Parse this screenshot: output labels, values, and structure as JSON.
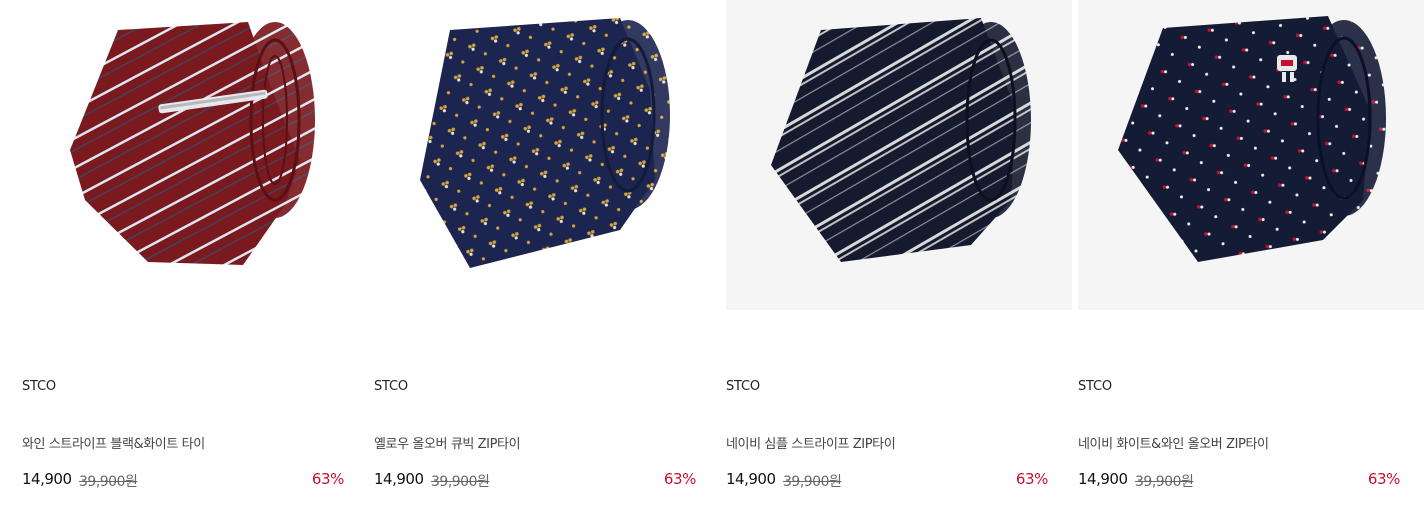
{
  "products": [
    {
      "brand": "STCO",
      "name": "와인 스트라이프 블랙&화이트 타이",
      "price": "14,900",
      "original_price": "39,900원",
      "discount": "63%",
      "image_icon": "tie-wine-stripe-image",
      "colors": {
        "base": "#7a1a1e",
        "stripe": "#dde6f2"
      }
    },
    {
      "brand": "STCO",
      "name": "옐로우 올오버 큐빅 ZIP타이",
      "price": "14,900",
      "original_price": "39,900원",
      "discount": "63%",
      "image_icon": "tie-navy-yellow-dots-image",
      "colors": {
        "base": "#1c2450",
        "stripe": "#d4a43a"
      }
    },
    {
      "brand": "STCO",
      "name": "네이비 심플 스트라이프 ZIP타이",
      "price": "14,900",
      "original_price": "39,900원",
      "discount": "63%",
      "image_icon": "tie-navy-stripe-image",
      "colors": {
        "base": "#151a2e",
        "stripe": "#d8d8d8"
      }
    },
    {
      "brand": "STCO",
      "name": "네이비 화이트&와인 올오버 ZIP타이",
      "price": "14,900",
      "original_price": "39,900원",
      "discount": "63%",
      "image_icon": "tie-navy-wine-dots-image",
      "colors": {
        "base": "#141b35",
        "stripe": "#c8102e"
      }
    }
  ],
  "theme": {
    "discount_color": "#c8102e",
    "text_color": "#222222"
  }
}
